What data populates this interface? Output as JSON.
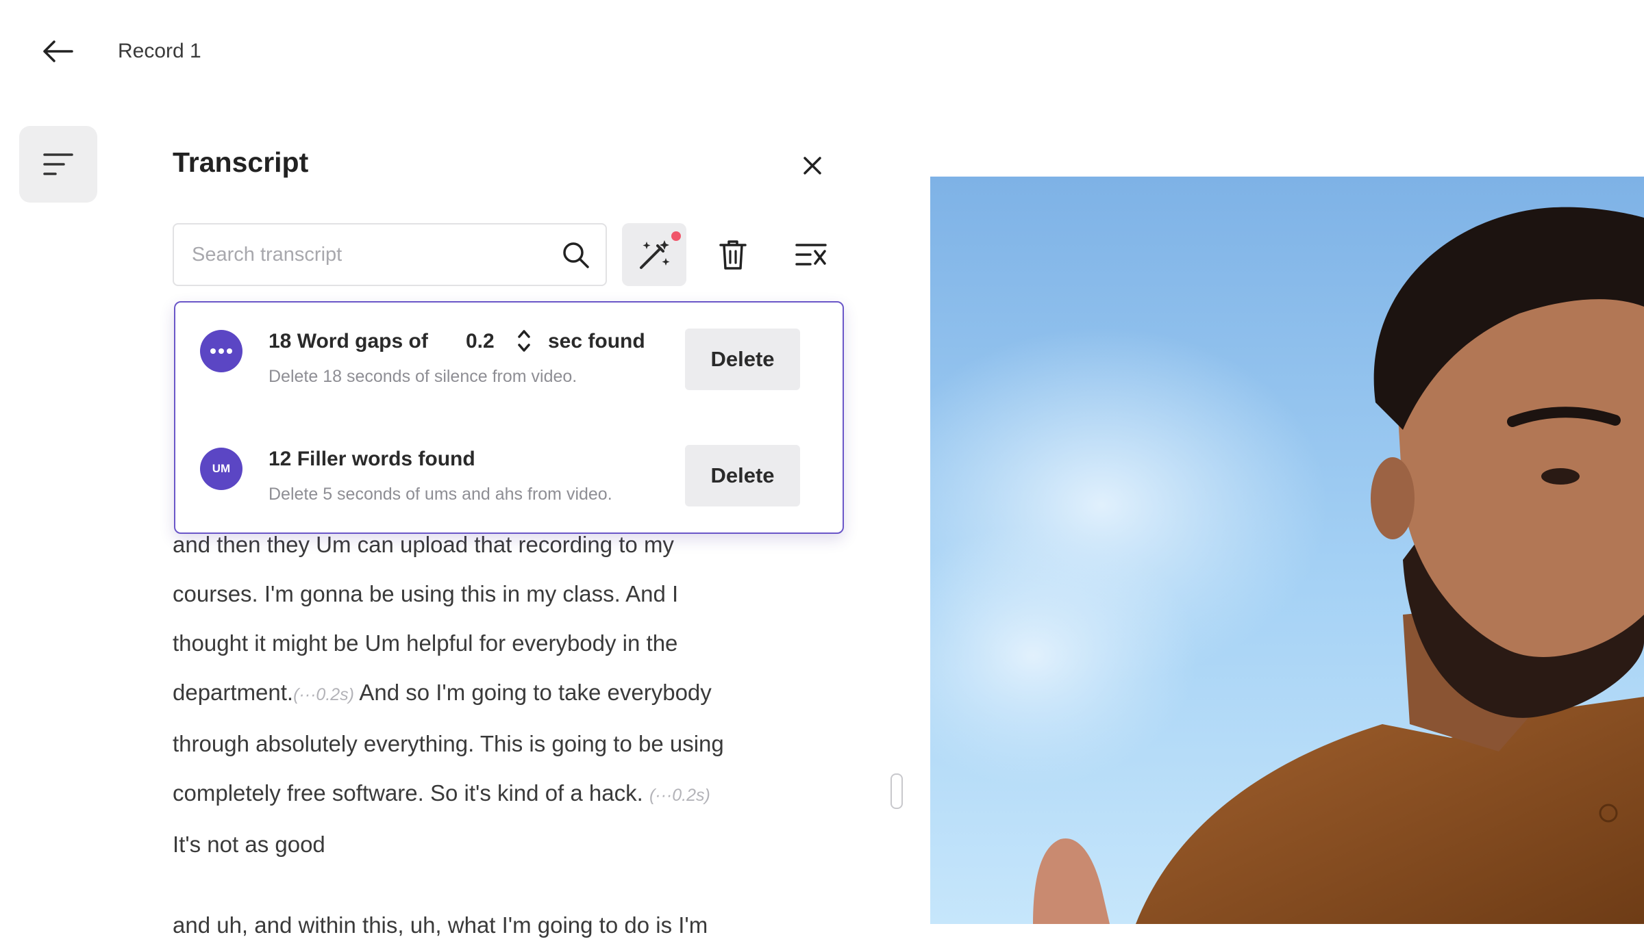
{
  "header": {
    "title": "Record 1"
  },
  "panel": {
    "title": "Transcript"
  },
  "search": {
    "placeholder": "Search transcript"
  },
  "popover": {
    "gaps": {
      "count_text": "18 Word gaps of",
      "value": "0.2",
      "unit_text": "sec found",
      "subtitle": "Delete 18 seconds of silence from video.",
      "button": "Delete",
      "icon": "dots-icon"
    },
    "fillers": {
      "title": "12 Filler words found",
      "subtitle": "Delete 5 seconds of ums and ahs from video.",
      "button": "Delete",
      "icon_text": "UM"
    }
  },
  "transcript": {
    "line1": "and then they Um can upload  that recording to my",
    "line2": "courses. I'm gonna be using this in my class. And I",
    "line3": "thought it might be Um helpful for everybody in the",
    "line4a": "department.",
    "gap1": "(···0.2s)",
    "line4b": " And so I'm going to take everybody",
    "line5": "through absolutely everything. This is going to be using",
    "line6a": "completely free software. So  it's kind of a hack. ",
    "gap2": "(···0.2s)",
    "line7": "It's not as good",
    "line8": "and uh, and within this, uh, what I'm going to do is I'm"
  },
  "colors": {
    "accent": "#5b46c4",
    "notification_dot": "#f0566a",
    "sky": "#9cc8ee"
  }
}
